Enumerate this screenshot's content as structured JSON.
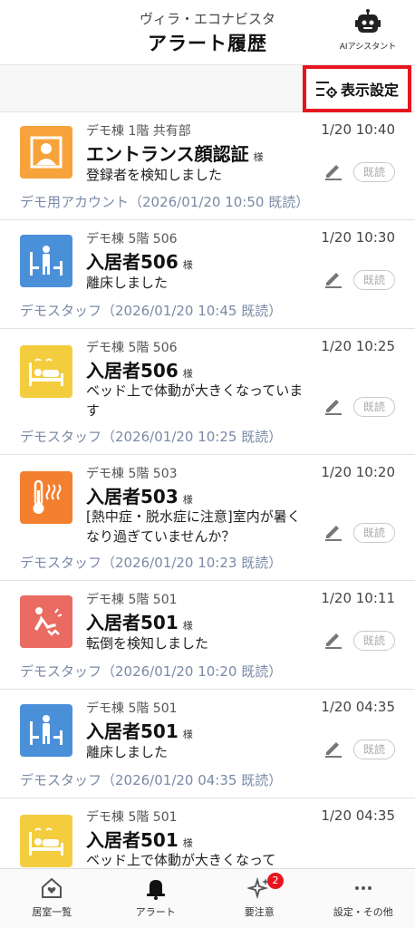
{
  "header": {
    "facility": "ヴィラ・エコナビスタ",
    "title": "アラート履歴",
    "ai_label": "AIアシスタント"
  },
  "toolbar": {
    "display_settings": "表示設定"
  },
  "icons": {
    "face": "face-recognition-icon",
    "leave": "leave-bed-icon",
    "motion": "bed-motion-icon",
    "heat": "heatstroke-thermometer-icon",
    "fall": "fall-detection-icon"
  },
  "colors": {
    "face": "#f7a33c",
    "leave": "#4a90d9",
    "motion": "#f4cd3e",
    "heat": "#f3802f",
    "fall": "#ea6b61",
    "highlight": "#e8141e",
    "staff_text": "#7a8aa6"
  },
  "alerts": [
    {
      "location": "デモ棟 1階 共有部",
      "time": "1/20 10:40",
      "name": "エントランス顔認証",
      "honorific": "様",
      "message": "登録者を検知しました",
      "read_label": "既読",
      "staff": "デモ用アカウント（2026/01/20 10:50 既読）"
    },
    {
      "location": "デモ棟 5階 506",
      "time": "1/20 10:30",
      "name": "入居者506",
      "honorific": "様",
      "message": "離床しました",
      "read_label": "既読",
      "staff": "デモスタッフ（2026/01/20 10:45 既読）"
    },
    {
      "location": "デモ棟 5階 506",
      "time": "1/20 10:25",
      "name": "入居者506",
      "honorific": "様",
      "message": "ベッド上で体動が大きくなっています",
      "read_label": "既読",
      "staff": "デモスタッフ（2026/01/20 10:25 既読）"
    },
    {
      "location": "デモ棟 5階 503",
      "time": "1/20 10:20",
      "name": "入居者503",
      "honorific": "様",
      "message": "[熱中症・脱水症に注意]室内が暑くなり過ぎていませんか？",
      "read_label": "既読",
      "staff": "デモスタッフ（2026/01/20 10:23 既読）"
    },
    {
      "location": "デモ棟 5階 501",
      "time": "1/20 10:11",
      "name": "入居者501",
      "honorific": "様",
      "message": "転倒を検知しました",
      "read_label": "既読",
      "staff": "デモスタッフ（2026/01/20 10:20 既読）"
    },
    {
      "location": "デモ棟 5階 501",
      "time": "1/20 04:35",
      "name": "入居者501",
      "honorific": "様",
      "message": "離床しました",
      "read_label": "既読",
      "staff": "デモスタッフ（2026/01/20 04:35 既読）"
    },
    {
      "location": "デモ棟 5階 501",
      "time": "1/20 04:35",
      "name": "入居者501",
      "honorific": "様",
      "message": "ベッド上で体動が大きくなって",
      "read_label": "",
      "staff": ""
    }
  ],
  "nav": {
    "rooms": "居室一覧",
    "alerts": "アラート",
    "attention": "要注意",
    "attention_badge": "2",
    "settings": "設定・その他"
  }
}
